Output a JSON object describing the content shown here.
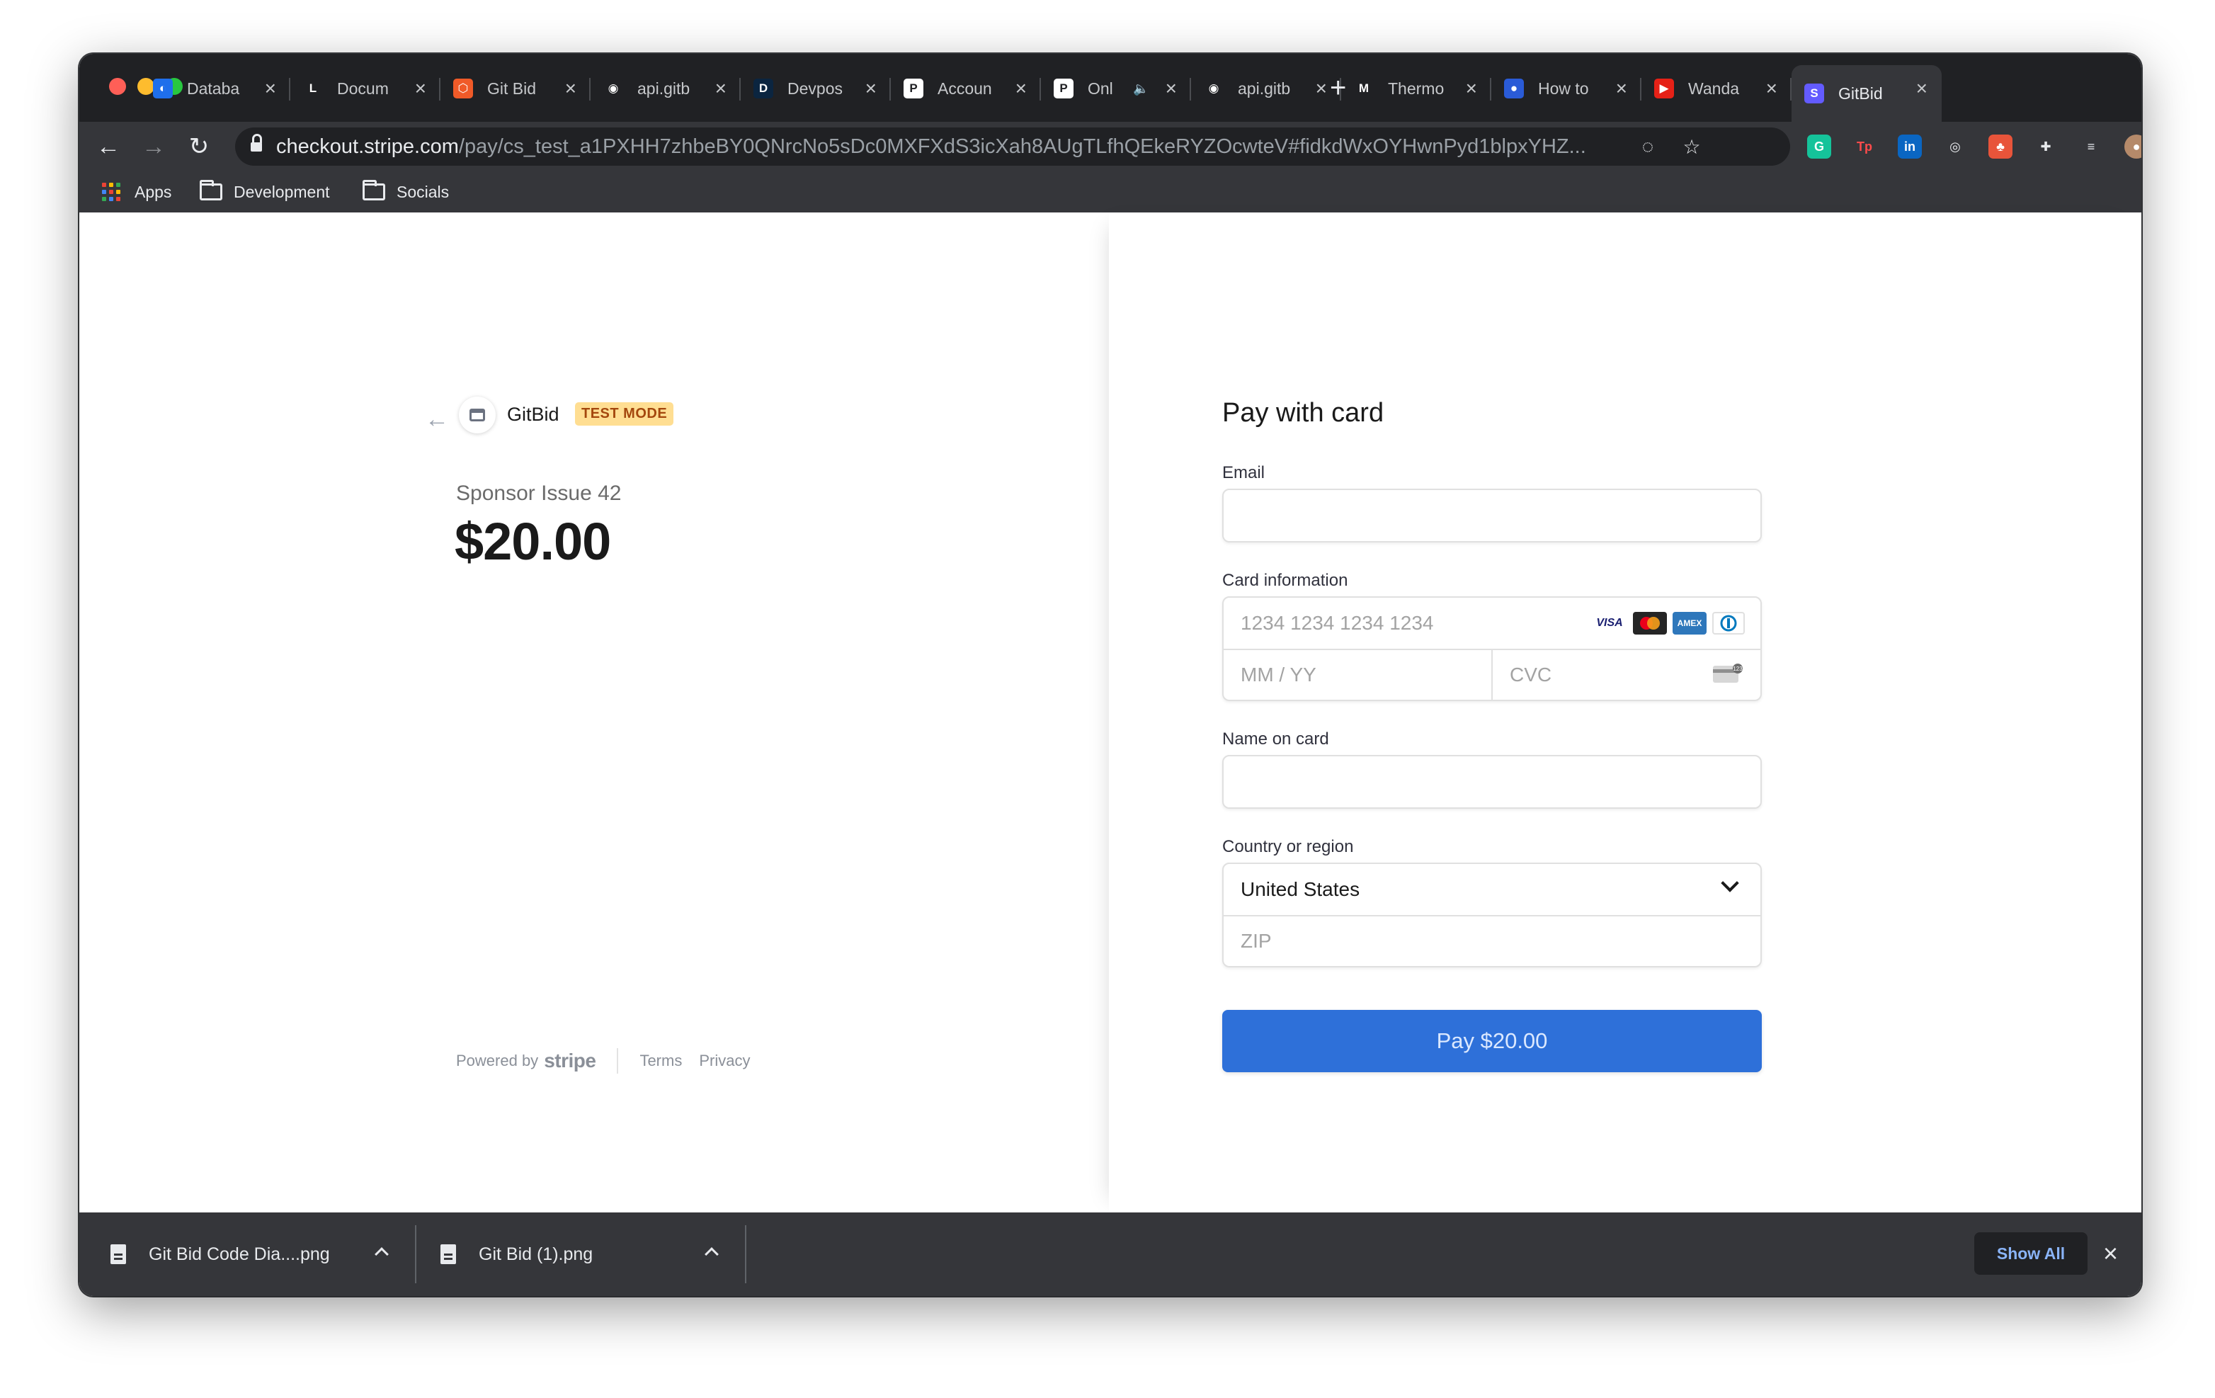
{
  "browser": {
    "tabs": [
      {
        "label": "Databa",
        "fav_bg": "#1f6feb",
        "fav_glyph": "◐"
      },
      {
        "label": "Docum",
        "fav_bg": "#202124",
        "fav_glyph": "L"
      },
      {
        "label": "Git Bid",
        "fav_bg": "#f05a28",
        "fav_glyph": "⬡"
      },
      {
        "label": "api.gitb",
        "fav_bg": "#202124",
        "fav_glyph": "◉"
      },
      {
        "label": "Devpos",
        "fav_bg": "#0b2540",
        "fav_glyph": "D"
      },
      {
        "label": "Accoun",
        "fav_bg": "#ffffff",
        "fav_glyph": "P"
      },
      {
        "label": "Onl",
        "fav_bg": "#ffffff",
        "fav_glyph": "P"
      },
      {
        "label": "api.gitb",
        "fav_bg": "#202124",
        "fav_glyph": "◉"
      },
      {
        "label": "Thermo",
        "fav_bg": "#202124",
        "fav_glyph": "M"
      },
      {
        "label": "How to",
        "fav_bg": "#2a5bd7",
        "fav_glyph": "●"
      },
      {
        "label": "Wanda",
        "fav_bg": "#e62117",
        "fav_glyph": "▶"
      },
      {
        "label": "GitBid",
        "fav_bg": "#635bff",
        "fav_glyph": "S"
      }
    ],
    "tab_close_glyph": "×",
    "tab_mute_glyph": "🔈",
    "new_tab_glyph": "+",
    "url_host": "checkout.stripe.com",
    "url_path": "/pay/cs_test_a1PXHH7zhbeBY0QNrcNo5sDc0MXFXdS3icXah8AUgTLfhQEkeRYZOcwteV#fidkdWxOYHwnPyd1blpxYHZ...",
    "bookmarks": [
      "Apps",
      "Development",
      "Socials"
    ],
    "extensions": [
      {
        "name": "grammarly-icon",
        "bg": "#15c39a",
        "glyph": "G"
      },
      {
        "name": "tp-icon",
        "bg": "#35363a",
        "glyph": "Tp"
      },
      {
        "name": "linkedin-icon",
        "bg": "#0a66c2",
        "glyph": "in"
      },
      {
        "name": "spy-icon",
        "bg": "#35363a",
        "glyph": "◎"
      },
      {
        "name": "tree-icon",
        "bg": "#e8543a",
        "glyph": "♣"
      },
      {
        "name": "puzzle-icon",
        "bg": "#35363a",
        "glyph": "✚"
      },
      {
        "name": "playlist-icon",
        "bg": "#35363a",
        "glyph": "≡"
      },
      {
        "name": "avatar",
        "bg": "#b58a6a",
        "glyph": "●"
      },
      {
        "name": "kebab-menu-icon",
        "bg": "#35363a",
        "glyph": "⋮"
      }
    ]
  },
  "merchant": {
    "name": "GitBid",
    "badge": "TEST MODE"
  },
  "product": {
    "name": "Sponsor Issue 42",
    "price": "$20.00"
  },
  "footer": {
    "powered_by": "Powered by",
    "brand": "stripe",
    "terms": "Terms",
    "privacy": "Privacy"
  },
  "form": {
    "title": "Pay with card",
    "email_label": "Email",
    "email_value": "",
    "card_label": "Card information",
    "card_number_placeholder": "1234 1234 1234 1234",
    "expiry_placeholder": "MM / YY",
    "cvc_placeholder": "CVC",
    "card_brands": [
      "VISA",
      "MC",
      "AMEX",
      "DC"
    ],
    "name_label": "Name on card",
    "name_value": "",
    "country_label": "Country or region",
    "country_value": "United States",
    "zip_placeholder": "ZIP",
    "pay_label": "Pay $20.00"
  },
  "downloads": {
    "items": [
      "Git Bid Code Dia....png",
      "Git Bid (1).png"
    ],
    "show_all": "Show All",
    "close_glyph": "×"
  }
}
